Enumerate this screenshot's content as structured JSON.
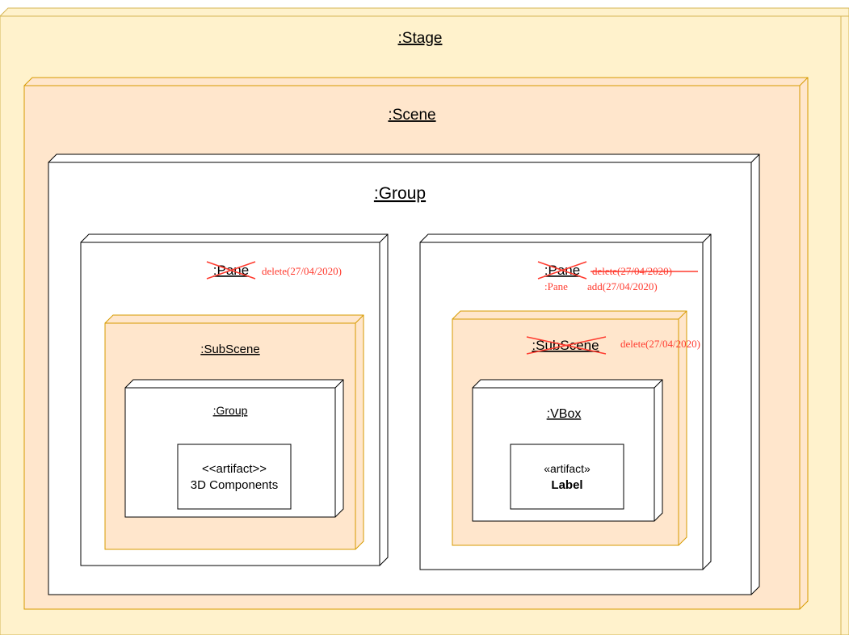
{
  "nodes": {
    "stage": ":Stage",
    "scene": ":Scene",
    "group": ":Group",
    "left_pane": ":Pane",
    "left_subscene": ":SubScene",
    "inner_group": ":Group",
    "artifact_left_stereotype": "<<artifact>>",
    "artifact_left_name": "3D Components",
    "right_pane": ":Pane",
    "right_subscene": ":SubScene",
    "vbox": ":VBox",
    "artifact_right_stereotype": "«artifact»",
    "artifact_right_name": "Label"
  },
  "annotations": {
    "left_pane_delete": "delete(27/04/2020)",
    "right_pane_delete": "delete(27/04/2020)",
    "right_pane_new_label": ":Pane",
    "right_pane_add": "add(27/04/2020)",
    "right_subscene_delete": "delete(27/04/2020)"
  },
  "colors": {
    "stage_fill": "#fff2cc",
    "stage_stroke": "#d6b656",
    "scene_fill": "#ffe6cc",
    "scene_stroke": "#d79b00",
    "white_fill": "#ffffff",
    "black_stroke": "#000000",
    "annotation": "#ff3b2f"
  }
}
